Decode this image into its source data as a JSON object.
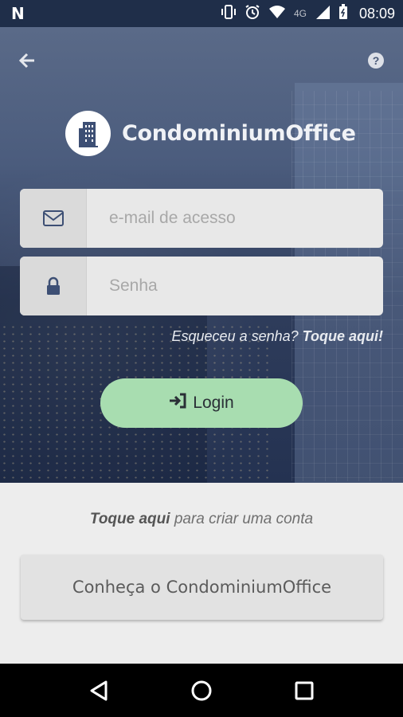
{
  "status_bar": {
    "time": "08:09",
    "network": "4G",
    "icons": [
      "n-logo-icon",
      "vibrate-icon",
      "alarm-icon",
      "wifi-icon",
      "signal-icon",
      "battery-icon"
    ]
  },
  "header": {
    "back_icon": "arrow-left-icon",
    "help_icon": "question-circle-icon"
  },
  "brand": {
    "name": "CondominiumOffice",
    "logo_icon": "building-icon"
  },
  "form": {
    "email_placeholder": "e-mail de acesso",
    "email_value": "",
    "password_placeholder": "Senha",
    "password_value": "",
    "forgot_prefix": "Esqueceu a senha?",
    "forgot_link": "Toque aqui!",
    "login_label": "Login",
    "login_icon": "sign-in-icon"
  },
  "footer": {
    "create_link": "Toque aqui",
    "create_text": "para criar uma conta",
    "know_button": "Conheça o CondominiumOffice"
  },
  "colors": {
    "status_bar": "#1f2e49",
    "login_button": "#a8ddb0",
    "panel": "#ededed",
    "field": "#e8e8e8"
  },
  "nav": {
    "icons": [
      "back-triangle-icon",
      "home-circle-icon",
      "recents-square-icon"
    ]
  }
}
